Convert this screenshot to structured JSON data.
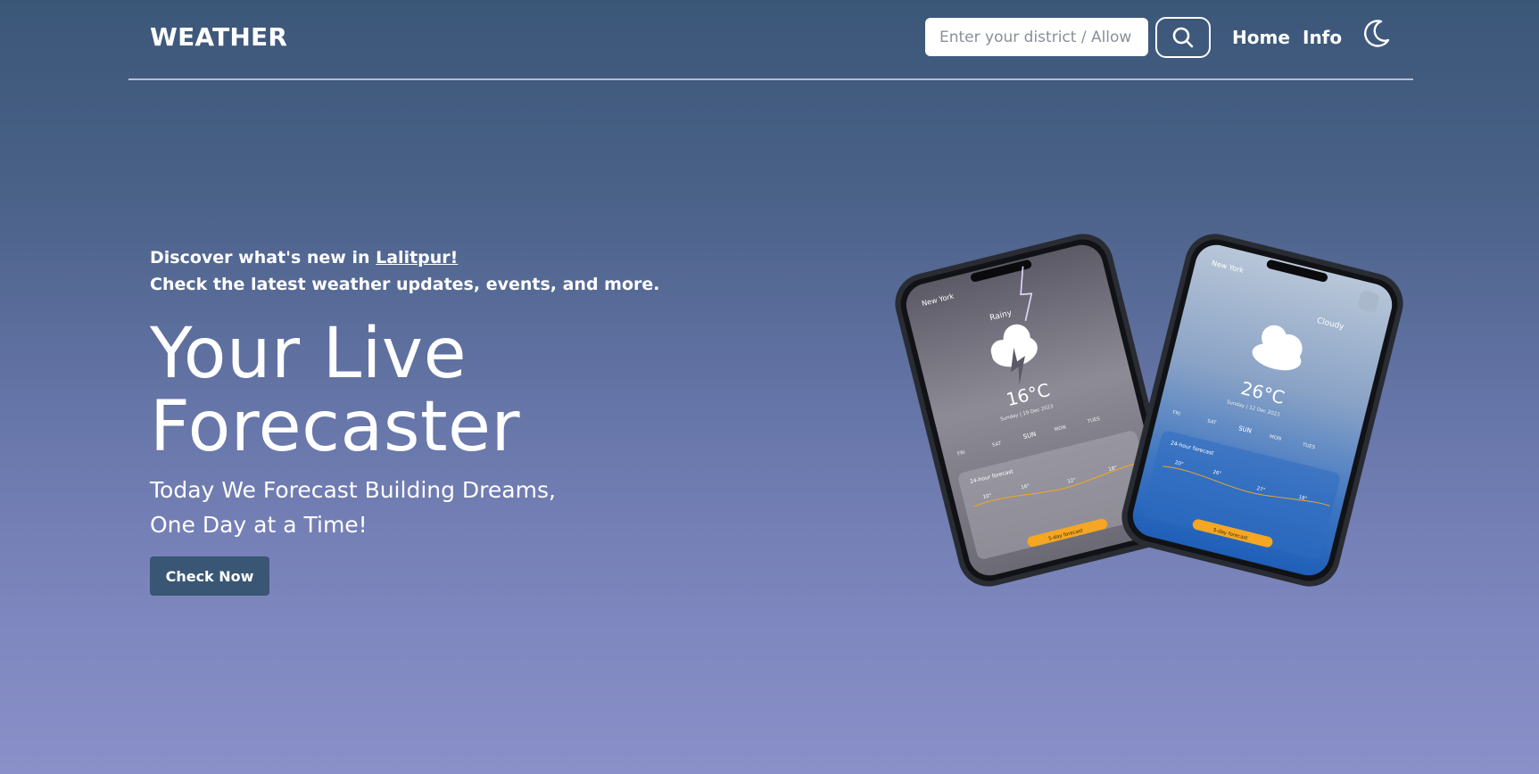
{
  "header": {
    "brand": "WEATHER",
    "search": {
      "placeholder": "Enter your district / Allow",
      "value": ""
    },
    "nav": {
      "home": "Home",
      "info": "Info"
    },
    "icons": {
      "search": "search-icon",
      "theme": "moon-icon"
    }
  },
  "hero": {
    "tagline_prefix": "Discover what's new in ",
    "tagline_city": "Lalitpur!",
    "tagline_line2": "Check the latest weather updates, events, and more.",
    "title_line1": "Your Live",
    "title_line2": "Forecaster",
    "subtitle_line1": "Today We Forecast Building Dreams,",
    "subtitle_line2": "One Day at a Time!",
    "cta_label": "Check Now"
  },
  "phones": {
    "left": {
      "location": "New York",
      "condition": "Rainy",
      "temperature": "16°C",
      "date": "Sunday | 19 Dec 2023",
      "days": [
        "FRI",
        "SAT",
        "SUN",
        "MON",
        "TUES"
      ],
      "forecast_title": "24-hour forecast",
      "hourly_temps": [
        "10°",
        "16°",
        "12°",
        "18°"
      ],
      "button": "5-day forecast"
    },
    "right": {
      "location": "New York",
      "condition": "Cloudy",
      "temperature": "26°C",
      "date": "Sunday | 12 Dec 2023",
      "days": [
        "FRI",
        "SAT",
        "SUN",
        "MON",
        "TUES"
      ],
      "forecast_title": "24-hour forecast",
      "hourly_temps": [
        "20°",
        "26°",
        "27°",
        "18°"
      ],
      "button": "5-day forecast"
    }
  },
  "colors": {
    "bg_top": "#3b5778",
    "bg_bottom": "#8a90c9",
    "cta_bg": "#3a5675",
    "phone_accent": "#f5a623"
  }
}
